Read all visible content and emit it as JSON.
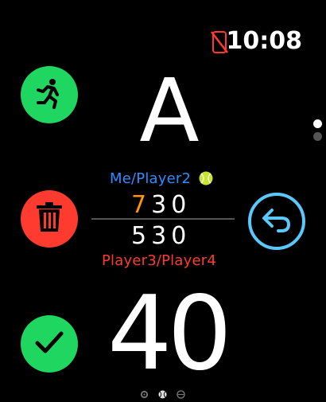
{
  "status": {
    "time": "10:08",
    "icon": "iphone-disconnected-icon"
  },
  "score": {
    "top_point": "A",
    "bottom_point": "40",
    "team1": "Me/Player2",
    "team2": "Player3/Player4",
    "team1_games": [
      "7",
      "3",
      "0"
    ],
    "team2_games": [
      "5",
      "3",
      "0"
    ],
    "serve_icon": "tennis-ball-icon"
  },
  "colors": {
    "green": "#1fd760",
    "red": "#ff3b30",
    "blue": "#2d8cff",
    "ring": "#5ac8fa",
    "orange": "#ff9500"
  },
  "buttons": {
    "workout": "running-person-icon",
    "delete": "trash-icon",
    "undo": "undo-arrow-icon",
    "confirm": "checkmark-icon"
  },
  "page_indicators": [
    "gear-icon",
    "tennis-ball-icon",
    "grid-icon"
  ]
}
